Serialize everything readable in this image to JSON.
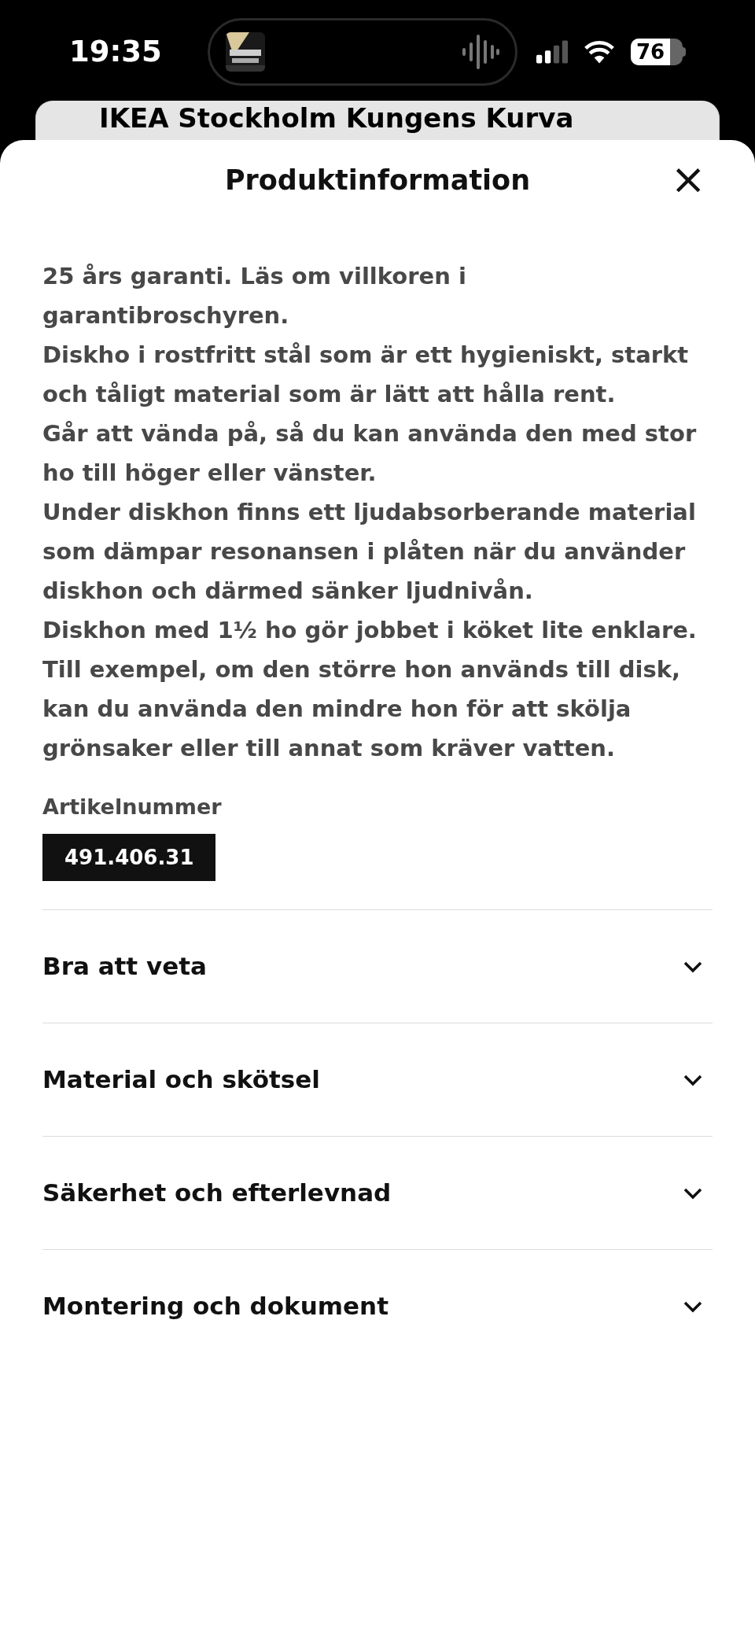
{
  "status_bar": {
    "time": "19:35",
    "battery": "76"
  },
  "background_card": {
    "title": "IKEA Stockholm Kungens Kurva"
  },
  "sheet": {
    "title": "Produktinformation",
    "close": "×",
    "paragraphs": [
      "25 års garanti. Läs om villkoren i garantibroschyren.",
      "Diskho i rostfritt stål som är ett hygieniskt, starkt och tåligt material som är lätt att hålla rent.",
      "Går att vända på, så du kan använda den med stor ho till höger eller vänster.",
      "Under diskhon finns ett ljudabsorberande material som dämpar resonansen i plåten när du använder diskhon och därmed sänker ljudnivån.",
      "Diskhon med 1½ ho gör jobbet i köket lite enklare. Till exempel, om den större hon används till disk, kan du använda den mindre hon för att skölja grönsaker eller till annat som kräver vatten."
    ],
    "article_label": "Artikelnummer",
    "article_number": "491.406.31",
    "sections": [
      {
        "label": "Bra att veta",
        "expanded": false
      },
      {
        "label": "Material och skötsel",
        "expanded": false
      },
      {
        "label": "Säkerhet och efterlevnad",
        "expanded": false
      },
      {
        "label": "Montering och dokument",
        "expanded": false
      }
    ]
  }
}
